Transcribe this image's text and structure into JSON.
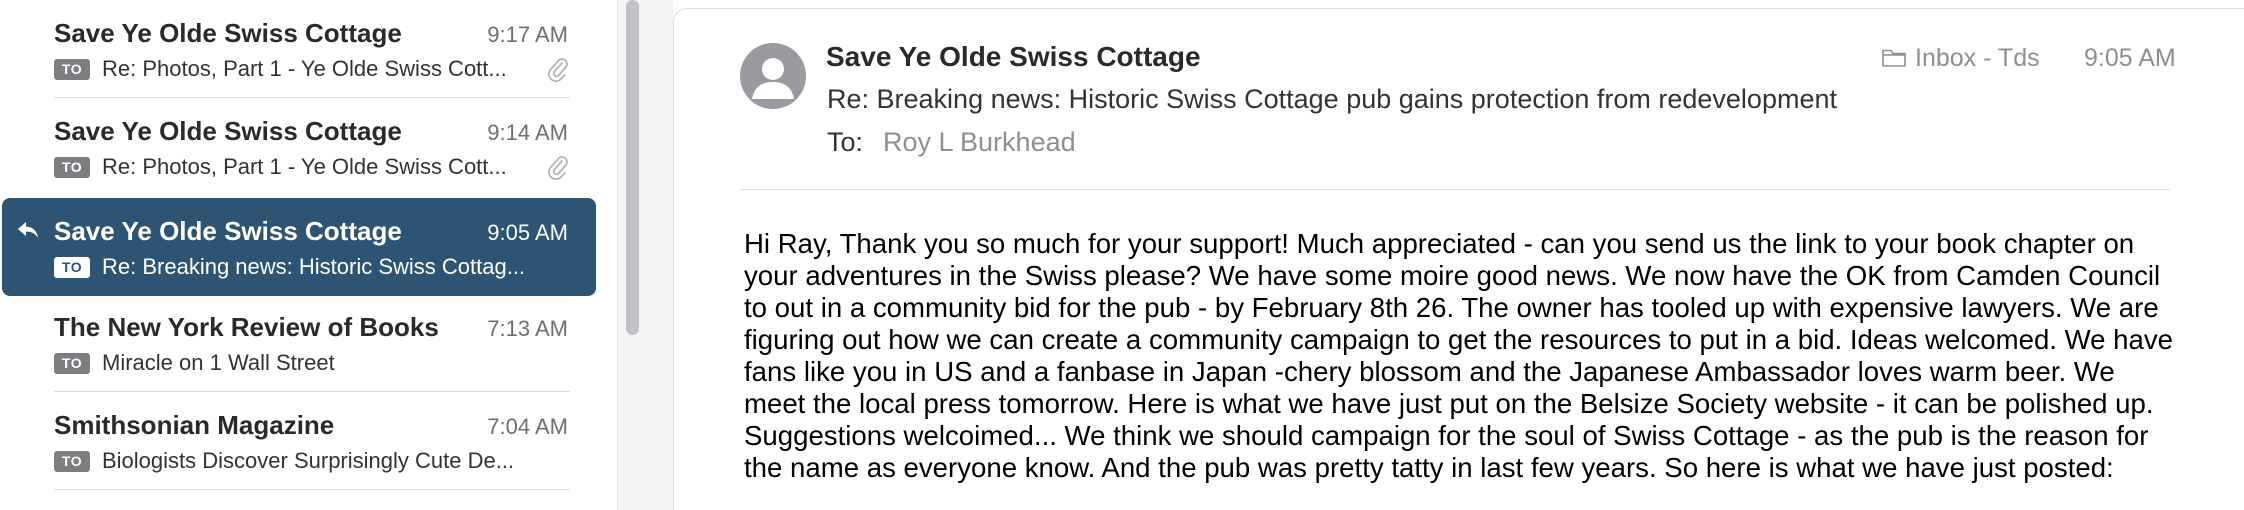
{
  "message_list": {
    "items": [
      {
        "sender": "Save Ye Olde Swiss Cottage",
        "time": "9:17 AM",
        "badge": "TO",
        "subject": "Re: Photos, Part 1 - Ye Olde Swiss Cott...",
        "has_attachment": true,
        "selected": false
      },
      {
        "sender": "Save Ye Olde Swiss Cottage",
        "time": "9:14 AM",
        "badge": "TO",
        "subject": "Re: Photos, Part 1 - Ye Olde Swiss Cott...",
        "has_attachment": true,
        "selected": false
      },
      {
        "sender": "Save Ye Olde Swiss Cottage",
        "time": "9:05 AM",
        "badge": "TO",
        "subject": "Re: Breaking news: Historic Swiss Cottag...",
        "has_attachment": false,
        "selected": true,
        "replied": true
      },
      {
        "sender": "The New York Review of Books",
        "time": "7:13 AM",
        "badge": "TO",
        "subject": "Miracle on 1 Wall Street",
        "has_attachment": false,
        "selected": false
      },
      {
        "sender": "Smithsonian Magazine",
        "time": "7:04 AM",
        "badge": "TO",
        "subject": "Biologists Discover Surprisingly Cute De...",
        "has_attachment": false,
        "selected": false
      }
    ]
  },
  "reader": {
    "from": "Save Ye Olde Swiss Cottage",
    "folder": "Inbox - Tds",
    "time": "9:05 AM",
    "subject": "Re: Breaking news: Historic Swiss Cottage pub gains protection from redevelopment",
    "to_label": "To:",
    "to_name": "Roy L Burkhead",
    "body_lines": [
      "Hi Ray, Thank you so much for your support! Much appreciated - can you send us the link to your book chapter on",
      "your adventures in the Swiss please?  We have some moire good news. We now have the OK from Camden Council",
      "to out in a community bid for the pub - by February 8th 26. The owner has tooled up with expensive lawyers.  We are",
      "figuring out how we can create a community campaign to get the resources to put in a bid. Ideas welcomed. We have",
      "fans like you in US and a fanbase in Japan -chery blossom and the Japanese Ambassador loves warm beer.  We",
      "meet the local press tomorrow. Here is what we have just put on the Belsize Society website - it can be polished up.",
      "Suggestions welcoimed... We think we should campaign for the soul of Swiss Cottage - as the pub is the reason for",
      "the name as everyone know. And the pub was pretty tatty in last few years.   So here is what we have just posted:"
    ]
  },
  "colors": {
    "selected_row": "#2d5573",
    "badge": "#7d7d82",
    "secondary_text": "#8e8e93"
  },
  "icons": {
    "reply": "reply-arrow-icon",
    "attachment": "paperclip-icon",
    "folder": "folder-icon",
    "avatar": "person-avatar-icon"
  }
}
